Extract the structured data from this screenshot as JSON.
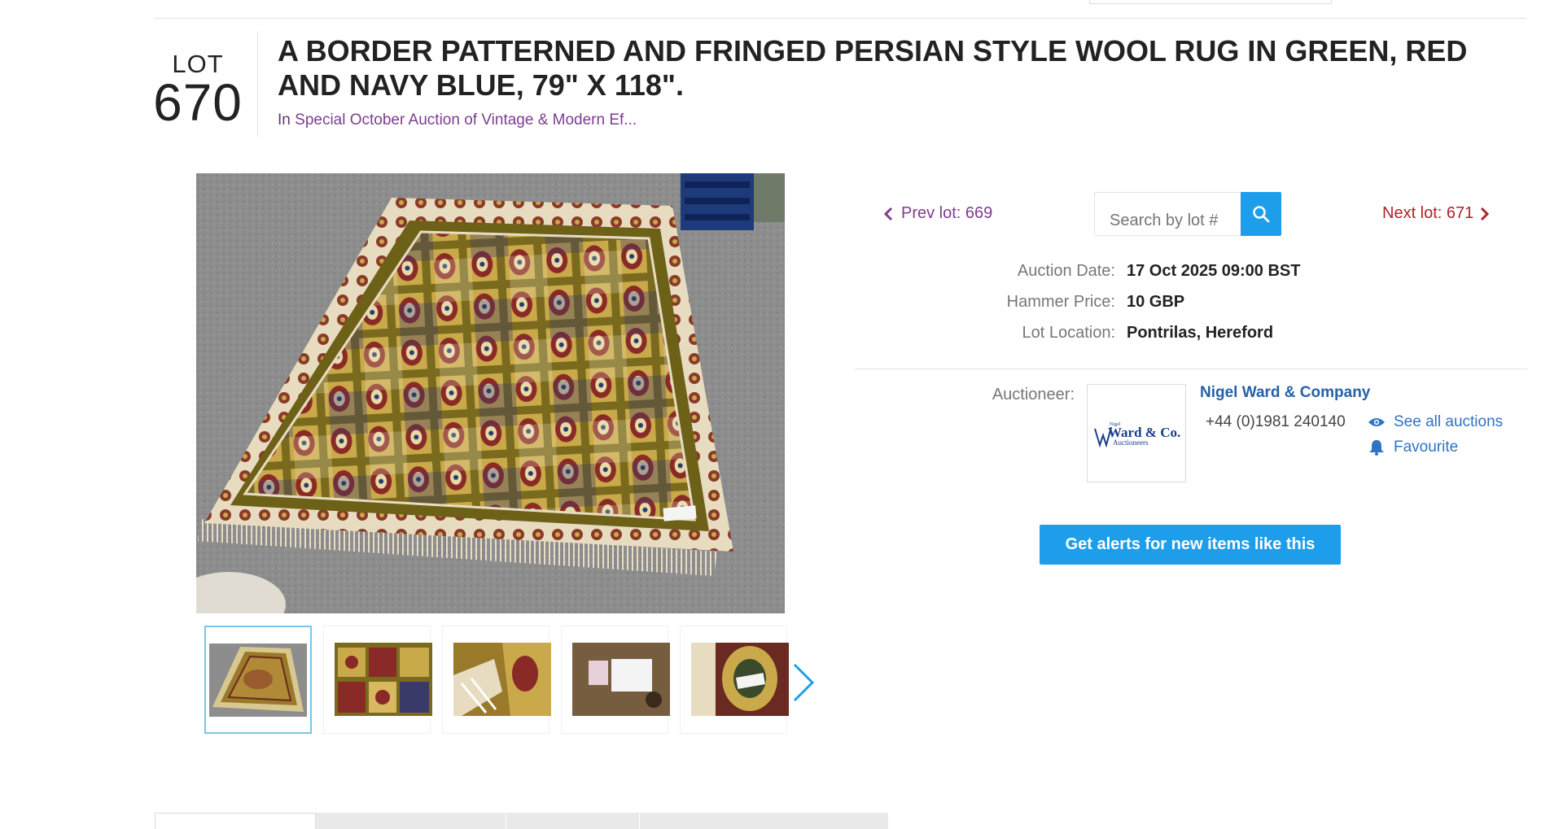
{
  "lot": {
    "label": "LOT",
    "number": "670",
    "title": "A BORDER PATTERNED AND FRINGED PERSIAN STYLE WOOL RUG IN GREEN, RED AND NAVY BLUE, 79\" X 118\".",
    "in_prefix": "In",
    "auction_name": "Special October Auction of Vintage & Modern Ef..."
  },
  "navigation": {
    "prev_label": "Prev lot: 669",
    "next_label": "Next lot: 671",
    "search_placeholder": "Search by lot #"
  },
  "details": [
    {
      "label": "Auction Date:",
      "value": "17 Oct 2025 09:00 BST"
    },
    {
      "label": "Hammer Price:",
      "value": "10 GBP"
    },
    {
      "label": "Lot Location:",
      "value": "Pontrilas, Hereford"
    }
  ],
  "auctioneer": {
    "label": "Auctioneer:",
    "name": "Nigel Ward & Company",
    "phone": "+44 (0)1981 240140",
    "see_all": "See all auctions",
    "favourite": "Favourite",
    "logo_text_main": "Ward & Co.",
    "logo_text_sub": "Auctioneers",
    "logo_text_top": "Nigel"
  },
  "alerts_button": "Get alerts for new items like this",
  "gallery": {
    "thumb_count": 5,
    "active_index": 0
  },
  "icons": {
    "prev": "chevron-left-icon",
    "next": "chevron-right-icon",
    "search": "search-icon",
    "eye": "eye-icon",
    "bell": "bell-icon",
    "gallery_next": "chevron-right-icon"
  },
  "colors": {
    "accent_blue": "#1e9eea",
    "prev_purple": "#7d3d8f",
    "next_red": "#b0232b",
    "auctioneer_blue": "#2760a8",
    "link_blue": "#2f73c2"
  }
}
